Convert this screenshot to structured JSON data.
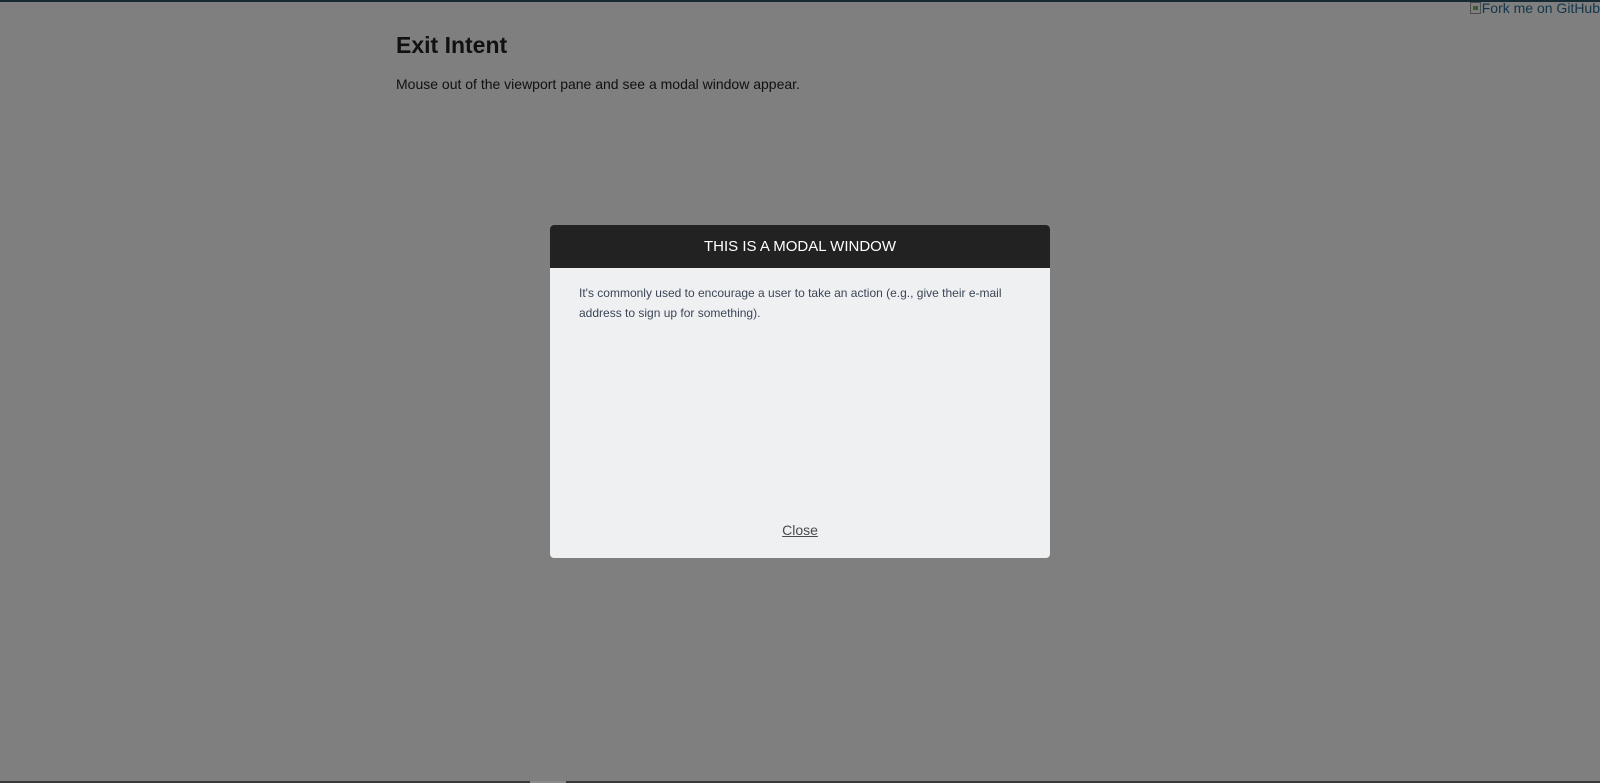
{
  "page": {
    "title": "Exit Intent",
    "description": "Mouse out of the viewport pane and see a modal window appear.",
    "fork_link": "Fork me on GitHub"
  },
  "modal": {
    "title": "THIS IS A MODAL WINDOW",
    "body": "It's commonly used to encourage a user to take an action (e.g., give their e-mail address to sign up for something).",
    "close_label": "Close"
  },
  "colors": {
    "overlay": "rgba(0,0,0,0.5)",
    "modal_header": "#222222",
    "modal_body": "#eff0f2",
    "link": "#2a6f97"
  },
  "icons": {
    "fork_image": "broken-image-icon"
  }
}
